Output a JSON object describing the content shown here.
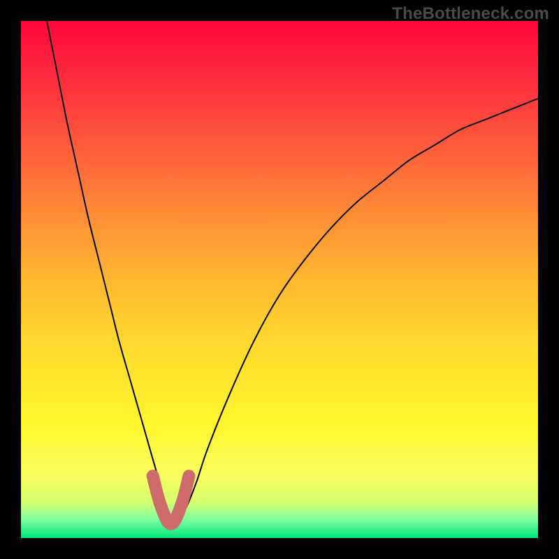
{
  "watermark": "TheBottleneck.com",
  "chart_data": {
    "type": "line",
    "title": "",
    "xlabel": "",
    "ylabel": "",
    "xlim": [
      0,
      100
    ],
    "ylim": [
      0,
      100
    ],
    "grid": false,
    "series": [
      {
        "name": "bottleneck-curve",
        "x": [
          5,
          7,
          9,
          11,
          13,
          15,
          17,
          19,
          21,
          23,
          25,
          27,
          28,
          29,
          30,
          32,
          34,
          36,
          40,
          45,
          50,
          55,
          60,
          65,
          70,
          75,
          80,
          85,
          90,
          95,
          100
        ],
        "y": [
          100,
          90,
          80,
          71,
          62,
          54,
          46,
          38,
          31,
          24,
          17,
          10,
          6,
          3,
          3,
          6,
          11,
          17,
          27,
          38,
          47,
          54,
          60,
          65,
          69,
          73,
          76,
          79,
          81,
          83,
          85
        ]
      }
    ],
    "highlight_segment": {
      "name": "optimal-range",
      "x": [
        25.5,
        26.5,
        27.5,
        28.5,
        29.5,
        30.5,
        31.5,
        32.5
      ],
      "y": [
        12,
        8,
        5,
        3,
        3,
        5,
        8,
        12
      ],
      "color": "#cf6a6a"
    },
    "background_gradient": {
      "stops": [
        {
          "offset": 0.0,
          "color": "#ff073a"
        },
        {
          "offset": 0.12,
          "color": "#ff2f3f"
        },
        {
          "offset": 0.28,
          "color": "#ff6a3a"
        },
        {
          "offset": 0.45,
          "color": "#ffa733"
        },
        {
          "offset": 0.62,
          "color": "#ffd92e"
        },
        {
          "offset": 0.78,
          "color": "#fff62e"
        },
        {
          "offset": 0.88,
          "color": "#f9ff60"
        },
        {
          "offset": 0.93,
          "color": "#d7ff70"
        },
        {
          "offset": 0.965,
          "color": "#7dffa0"
        },
        {
          "offset": 1.0,
          "color": "#00e47a"
        }
      ]
    }
  }
}
